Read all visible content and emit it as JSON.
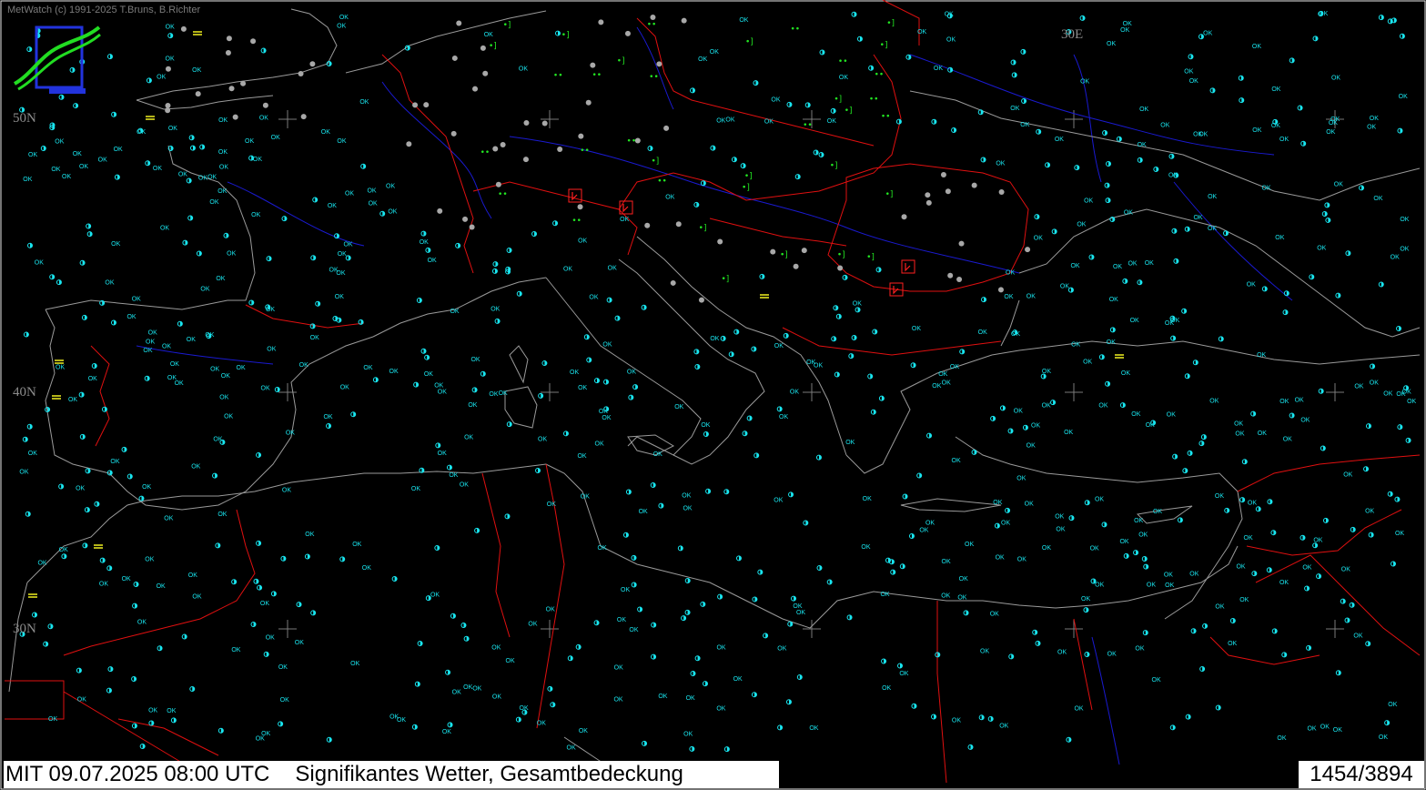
{
  "app": {
    "copyright": "MetWatch  (c) 1991-2025 T.Bruns, B.Richter",
    "logo_icon": "metwatch-logo-icon"
  },
  "grid": {
    "lat_labels": [
      "50N",
      "40N",
      "30N"
    ],
    "lon_labels": [
      "30E"
    ]
  },
  "status": {
    "datetime": "MIT 09.07.2025 08:00 UTC",
    "product": "Signifikantes Wetter, Gesamtbedeckung",
    "station_count": "1454/3894"
  },
  "colors": {
    "background": "#000000",
    "coastline": "#9a9a9a",
    "border": "#e01010",
    "river": "#1a1ad0",
    "ok_clear": "#19e6f0",
    "overcast": "#a8a8a8",
    "precip": "#22e622",
    "fog_haze": "#f0f020",
    "thunder": "#ff2020"
  },
  "legend_icons": [
    "ok-clear-icon",
    "cloud-cover-disc-icon",
    "rain-icon",
    "shower-icon",
    "fog-icon",
    "thunderstorm-icon"
  ]
}
